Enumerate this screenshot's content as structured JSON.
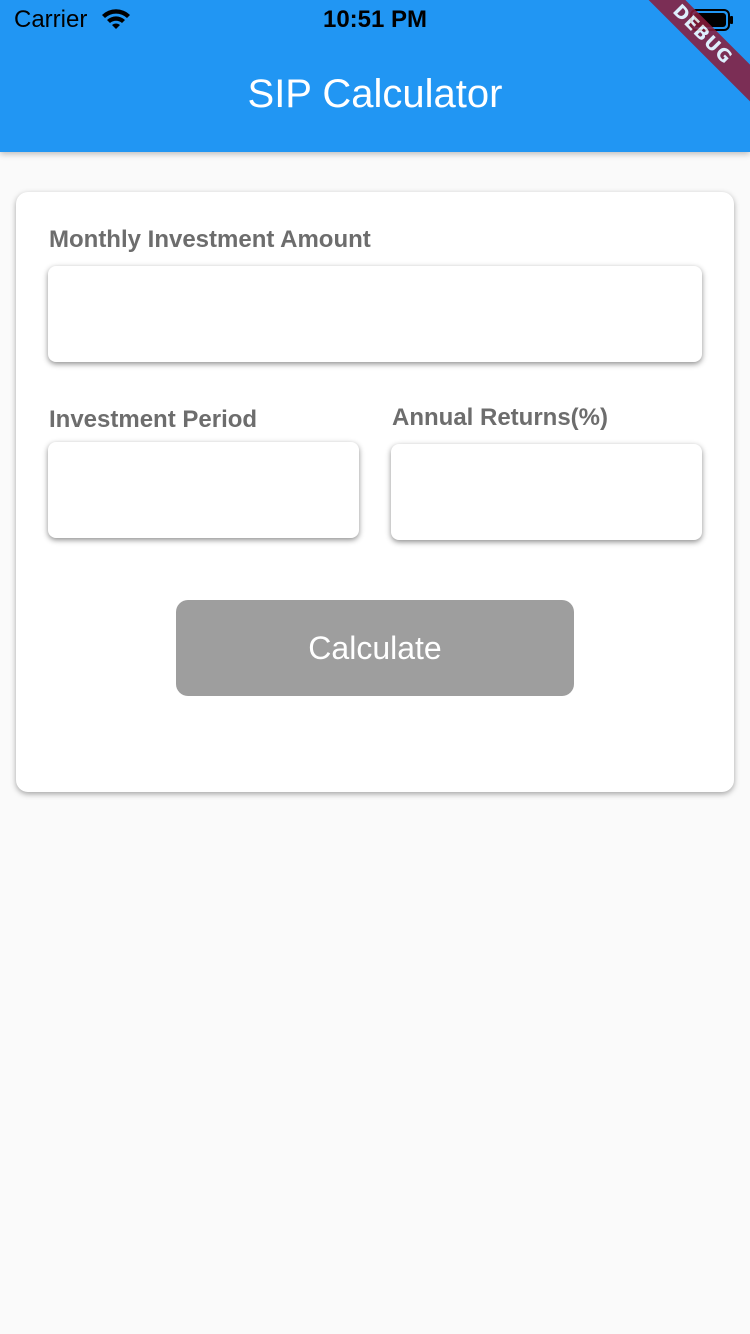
{
  "status_bar": {
    "carrier": "Carrier",
    "time": "10:51 PM",
    "wifi_icon": "wifi-icon",
    "battery_icon": "battery-icon"
  },
  "app_bar": {
    "title": "SIP Calculator",
    "background_color": "#2196f3",
    "debug_banner": "DEBUG"
  },
  "form": {
    "monthly_label": "Monthly Investment Amount",
    "monthly_value": "",
    "period_label": "Investment Period",
    "period_value": "",
    "returns_label": "Annual Returns(%)",
    "returns_value": "",
    "calculate_label": "Calculate",
    "calculate_color": "#9e9e9e"
  }
}
